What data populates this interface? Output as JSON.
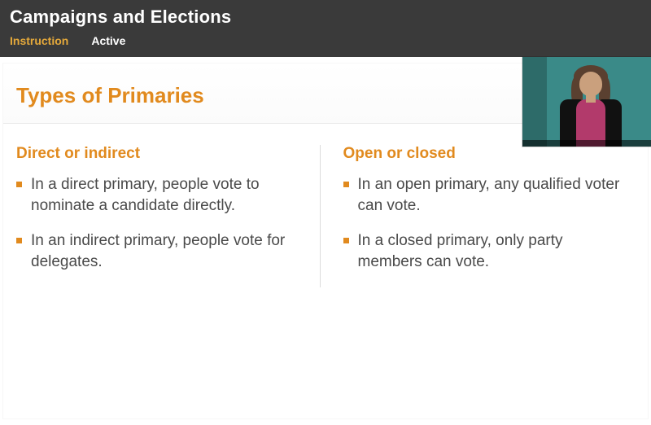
{
  "header": {
    "title": "Campaigns and Elections",
    "tabs": {
      "instruction": "Instruction",
      "active": "Active"
    }
  },
  "slide": {
    "title": "Types of Primaries",
    "left": {
      "heading": "Direct or indirect",
      "items": [
        "In a direct primary, people vote to nominate a candidate directly.",
        "In an indirect primary, people vote for delegates."
      ]
    },
    "right": {
      "heading": "Open or closed",
      "items": [
        "In an open primary, any qualified voter can vote.",
        "In a closed primary, only party members can vote."
      ]
    }
  }
}
